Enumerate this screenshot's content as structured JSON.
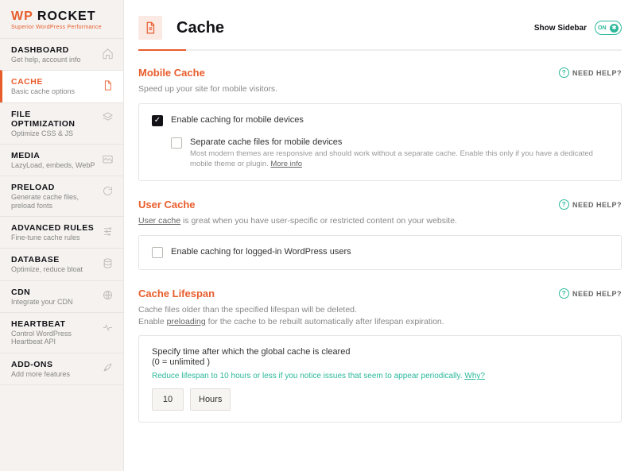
{
  "brand": {
    "wp": "WP",
    "rocket": " ROCKET",
    "tagline": "Superior WordPress Performance"
  },
  "sidebar": {
    "items": [
      {
        "title": "DASHBOARD",
        "desc": "Get help, account info"
      },
      {
        "title": "CACHE",
        "desc": "Basic cache options"
      },
      {
        "title": "FILE OPTIMIZATION",
        "desc": "Optimize CSS & JS"
      },
      {
        "title": "MEDIA",
        "desc": "LazyLoad, embeds, WebP"
      },
      {
        "title": "PRELOAD",
        "desc": "Generate cache files, preload fonts"
      },
      {
        "title": "ADVANCED RULES",
        "desc": "Fine-tune cache rules"
      },
      {
        "title": "DATABASE",
        "desc": "Optimize, reduce bloat"
      },
      {
        "title": "CDN",
        "desc": "Integrate your CDN"
      },
      {
        "title": "HEARTBEAT",
        "desc": "Control WordPress Heartbeat API"
      },
      {
        "title": "ADD-ONS",
        "desc": "Add more features"
      }
    ]
  },
  "header": {
    "title": "Cache",
    "showSidebarLabel": "Show Sidebar",
    "toggleState": "ON"
  },
  "needHelpLabel": "NEED HELP?",
  "mobile": {
    "title": "Mobile Cache",
    "desc": "Speed up your site for mobile visitors.",
    "opt1": "Enable caching for mobile devices",
    "opt2": "Separate cache files for mobile devices",
    "opt2desc": "Most modern themes are responsive and should work without a separate cache. Enable this only if you have a dedicated mobile theme or plugin. ",
    "moreInfo": "More info"
  },
  "user": {
    "title": "User Cache",
    "descLink": "User cache",
    "descRest": " is great when you have user-specific or restricted content on your website.",
    "opt1": "Enable caching for logged-in WordPress users"
  },
  "lifespan": {
    "title": "Cache Lifespan",
    "desc1": "Cache files older than the specified lifespan will be deleted.",
    "desc2a": "Enable ",
    "desc2link": "preloading",
    "desc2b": " for the cache to be rebuilt automatically after lifespan expiration.",
    "lead": "Specify time after which the global cache is cleared",
    "sub": "(0 = unlimited )",
    "note": "Reduce lifespan to 10 hours or less if you notice issues that seem to appear periodically. ",
    "why": "Why?",
    "value": "10",
    "unit": "Hours"
  }
}
